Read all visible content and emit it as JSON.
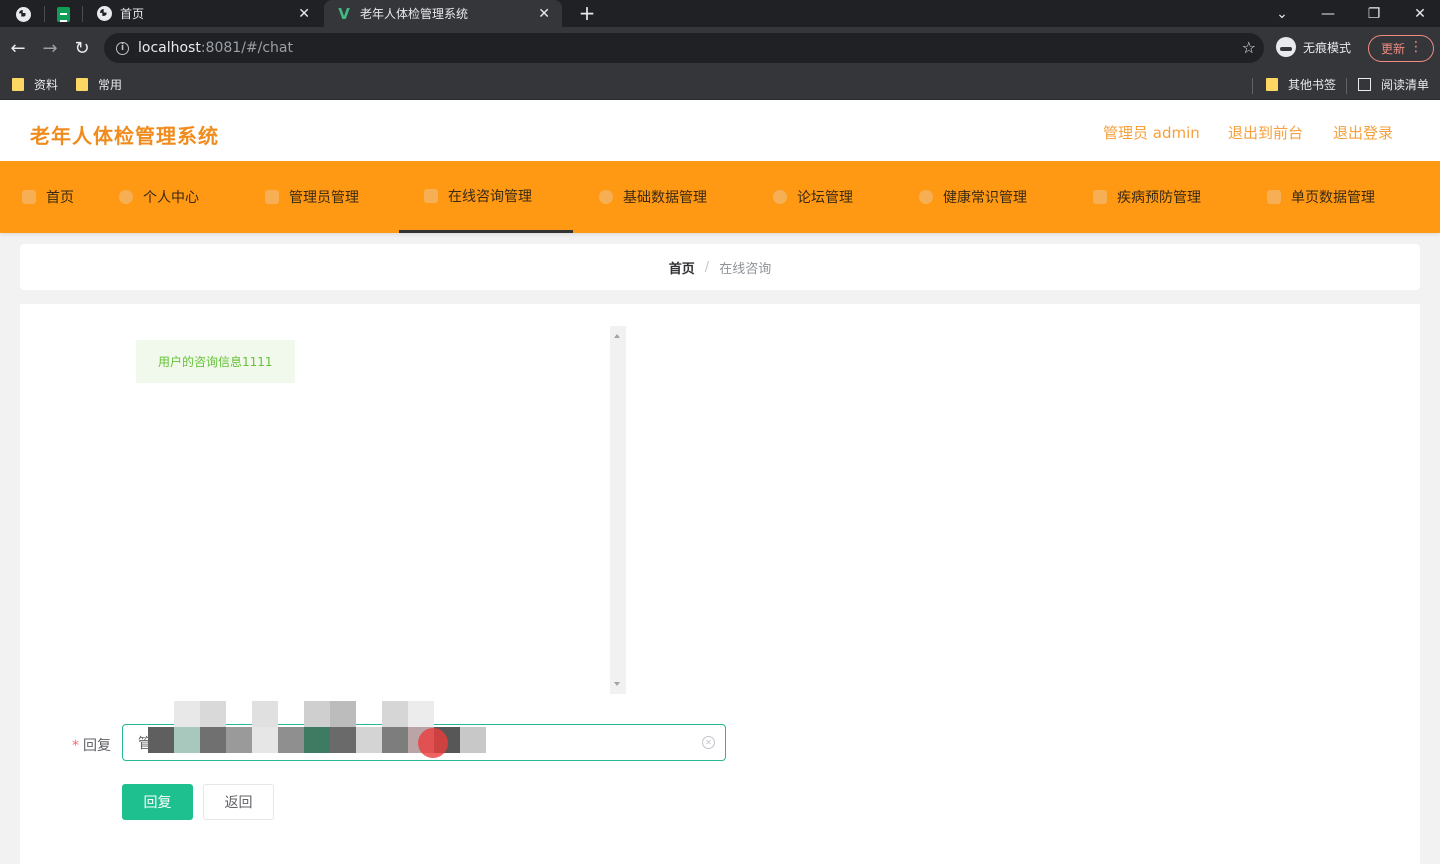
{
  "browser": {
    "tabs": [
      {
        "title": "首页",
        "icon": "globe-icon"
      },
      {
        "title": "老年人体检管理系统",
        "icon": "vue-logo-icon",
        "vue_mark": "V"
      }
    ],
    "new_tab": "+",
    "url_host": "localhost",
    "url_rest": ":8081/#/chat",
    "incognito_label": "无痕模式",
    "update_label": "更新",
    "bookmarks": [
      "资料",
      "常用"
    ],
    "other_bookmarks": "其他书签",
    "reading_list": "阅读清单",
    "colors": {
      "tabbar": "#202124",
      "toolbar": "#35363a",
      "folder": "#fdd663"
    }
  },
  "header": {
    "title": "老年人体检管理系统",
    "admin_label": "管理员 admin",
    "to_front": "退出到前台",
    "logout": "退出登录"
  },
  "nav": {
    "items": [
      {
        "label": "首页",
        "icon": "home-icon"
      },
      {
        "label": "个人中心",
        "icon": "user-icon"
      },
      {
        "label": "管理员管理",
        "icon": "admin-icon"
      },
      {
        "label": "在线咨询管理",
        "icon": "chart-icon",
        "active": true
      },
      {
        "label": "基础数据管理",
        "icon": "data-icon"
      },
      {
        "label": "论坛管理",
        "icon": "forum-icon"
      },
      {
        "label": "健康常识管理",
        "icon": "health-icon"
      },
      {
        "label": "疾病预防管理",
        "icon": "disease-icon"
      },
      {
        "label": "单页数据管理",
        "icon": "page-icon"
      }
    ],
    "color": "#ff9812"
  },
  "breadcrumb": {
    "home": "首页",
    "sep": "/",
    "current": "在线咨询"
  },
  "chat": {
    "messages": [
      {
        "text": "用户的咨询信息1111",
        "from": "user"
      }
    ]
  },
  "form": {
    "required_mark": "*",
    "label": "回复",
    "value": "管",
    "reply_button": "回复",
    "back_button": "返回"
  },
  "colors": {
    "accent": "#f08c1e",
    "primary_button": "#1ec08f",
    "message_bg": "#f0f9eb",
    "message_text": "#67c23a"
  }
}
